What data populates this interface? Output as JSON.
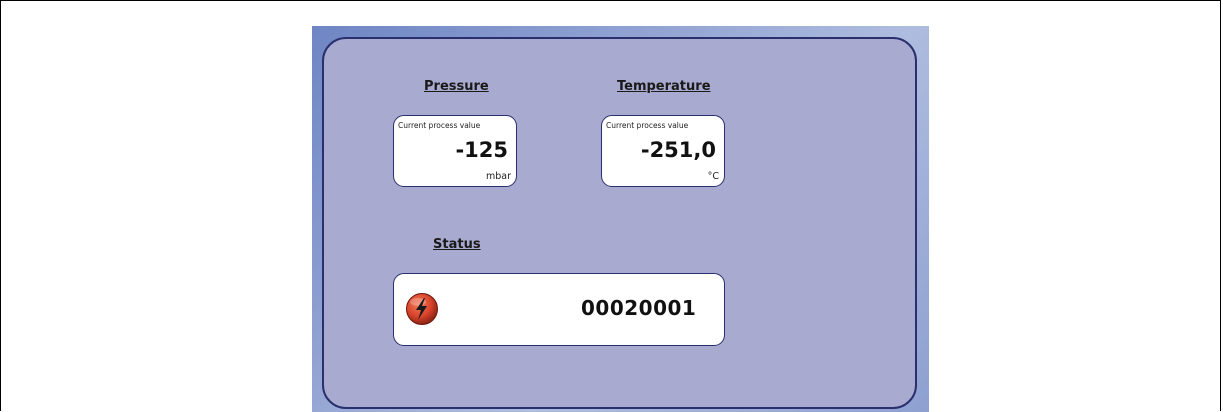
{
  "pressure": {
    "title": "Pressure",
    "caption": "Current process value",
    "value": "-125",
    "unit": "mbar"
  },
  "temperature": {
    "title": "Temperature",
    "caption": "Current process value",
    "value": "-251,0",
    "unit": "°C"
  },
  "status": {
    "title": "Status",
    "code": "00020001",
    "icon": "lightning-fault-icon"
  },
  "colors": {
    "panel": "#a9aacf",
    "border": "#2a2f6e",
    "fault_icon": "#d9442b"
  }
}
